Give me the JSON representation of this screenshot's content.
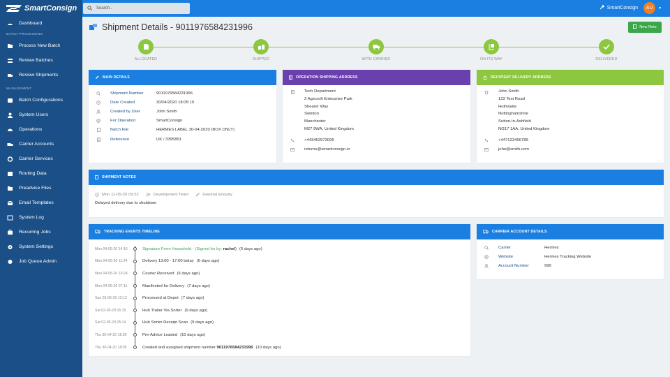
{
  "brand": {
    "name": "SmartConsign"
  },
  "search": {
    "placeholder": "Search.."
  },
  "topbar": {
    "account": "SmartConsign",
    "avatar_initials": "AU"
  },
  "sidebar": {
    "items": [
      {
        "label": "Dashboard",
        "icon": "dashboard-icon"
      },
      {
        "section": "BATCH PROCESSING"
      },
      {
        "label": "Process New Batch",
        "icon": "process-icon"
      },
      {
        "label": "Review Batches",
        "icon": "batches-icon"
      },
      {
        "label": "Review Shipments",
        "icon": "shipments-icon"
      },
      {
        "section": "MANAGEMENT"
      },
      {
        "label": "Batch Configurations",
        "icon": "config-icon"
      },
      {
        "label": "System Users",
        "icon": "users-icon"
      },
      {
        "label": "Operations",
        "icon": "operations-icon"
      },
      {
        "label": "Carrier Accounts",
        "icon": "carrier-icon"
      },
      {
        "label": "Carrier Services",
        "icon": "services-icon"
      },
      {
        "label": "Routing Data",
        "icon": "routing-icon"
      },
      {
        "label": "Preadvice Files",
        "icon": "files-icon"
      },
      {
        "label": "Email Templates",
        "icon": "email-icon"
      },
      {
        "label": "System Log",
        "icon": "log-icon"
      },
      {
        "label": "Recurring Jobs",
        "icon": "jobs-icon"
      },
      {
        "label": "System Settings",
        "icon": "settings-icon"
      },
      {
        "label": "Job Queue Admin",
        "icon": "queue-icon"
      }
    ]
  },
  "page": {
    "title": "Shipment Details - 9011976584231996",
    "new_note_label": "New Note"
  },
  "progress": {
    "steps": [
      {
        "label": "ALLOCATED"
      },
      {
        "label": "SHIPPED"
      },
      {
        "label": "WITH CARRIER"
      },
      {
        "label": "ON ITS WAY"
      },
      {
        "label": "DELIVERED"
      }
    ],
    "color": "#8dc63f"
  },
  "main_details": {
    "title": "MAIN DETAILS",
    "rows": [
      {
        "key": "Shipment Number",
        "value": "9011976584231996"
      },
      {
        "key": "Date Created",
        "value": "30/04/2020 18:05:10"
      },
      {
        "key": "Created by User",
        "value": "John Smith"
      },
      {
        "key": "For Operation",
        "value": "SmartConsign"
      },
      {
        "key": "Batch File",
        "value": "HERMES LABEL 30-04-2020 (BOX ONLY)"
      },
      {
        "key": "Reference",
        "value": "UK / 3395891"
      }
    ]
  },
  "operation_address": {
    "title": "OPERATION SHIPPING ADDRESS",
    "lines": [
      "Tech Department",
      "2 Agecroft Enterprise Park",
      "Shearer Way",
      "Swinton",
      "Manchester",
      "M27 8WA, United Kingdom"
    ],
    "phone": "+443452573005",
    "email": "returns@smartconsign.io"
  },
  "recipient_address": {
    "title": "RECIPIENT DELIVERY ADDRESS",
    "lines": [
      "John Smith",
      "123 Test Road",
      "Huthwaite",
      "Nottinghamshire",
      "Sutton-In-Ashfield",
      "NG17 1AA, United Kingdom"
    ],
    "phone": "+447123456789",
    "email": "john@smith.com"
  },
  "notes": {
    "title": "SHIPMENT NOTES",
    "date": "Mon 11-05-20 09:22",
    "team": "Development Team",
    "category": "General Enquiry",
    "text": "Delayed delivery due to shutdown"
  },
  "timeline": {
    "title": "TRACKING EVENTS TIMELINE",
    "events": [
      {
        "date": "Mon 04-05-20 14:16",
        "text": "Signature From Household - (Signed for by: ",
        "signer": "rachel",
        "after": ")",
        "ago": "(6 days ago)"
      },
      {
        "date": "Mon 04-05-20 11:24",
        "text": "Delivery 13:00 - 17:00 today",
        "ago": "(6 days ago)"
      },
      {
        "date": "Mon 04-05-20 10:24",
        "text": "Courier Received",
        "ago": "(6 days ago)"
      },
      {
        "date": "Mon 04-05-20 07:11",
        "text": "Manifested for Delivery",
        "ago": "(7 days ago)"
      },
      {
        "date": "Sun 03-05-20 12:13",
        "text": "Processed at Depot",
        "ago": "(7 days ago)"
      },
      {
        "date": "Sat 02-05-20 05:15",
        "text": "Hub Trailer Via Sorter",
        "ago": "(9 days ago)"
      },
      {
        "date": "Sat 02-05-20 05:14",
        "text": "Hub Sorter Receipt Scan",
        "ago": "(9 days ago)"
      },
      {
        "date": "Thu 30-04-20 18:05",
        "text": "Pre-Advice Loaded",
        "ago": "(10 days ago)"
      },
      {
        "date": "Thu 30-04-20 18:05",
        "text": "Created and assigned shipment number ",
        "bold": "9011976584231996",
        "ago": "(10 days ago)"
      }
    ]
  },
  "carrier": {
    "title": "CARRIER ACCOUNT DETAILS",
    "rows": [
      {
        "key": "Carrier",
        "value": "Hermes"
      },
      {
        "key": "Website",
        "value": "Hermes Tracking Website"
      },
      {
        "key": "Account Number",
        "value": "999"
      }
    ]
  },
  "colors": {
    "sidebar": "#1a4f87",
    "topbar": "#1a7fe0",
    "purple": "#6a3fae",
    "green": "#8dc63f",
    "button": "#3ca64b"
  }
}
